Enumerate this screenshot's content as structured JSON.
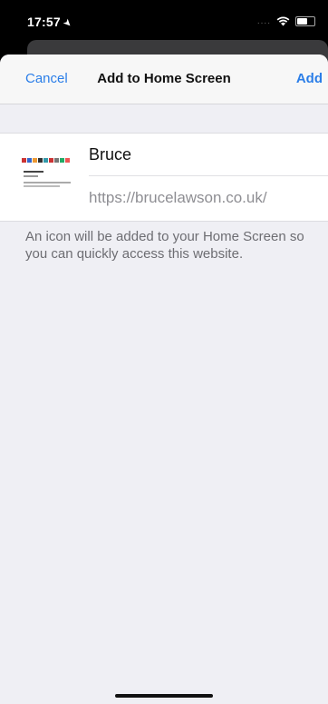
{
  "status": {
    "time": "17:57",
    "location_icon": "location-arrow-icon",
    "wifi_icon": "wifi-icon",
    "battery_icon": "battery-icon",
    "signal_text": "...."
  },
  "nav": {
    "cancel_label": "Cancel",
    "title": "Add to Home Screen",
    "add_label": "Add"
  },
  "form": {
    "name_value": "Bruce",
    "url": "https://brucelawson.co.uk/"
  },
  "hint": {
    "text": "An icon will be added to your Home Screen so you can quickly access this website."
  },
  "colors": {
    "accent": "#2b7ee8",
    "sheet_bg": "#efeff4"
  }
}
